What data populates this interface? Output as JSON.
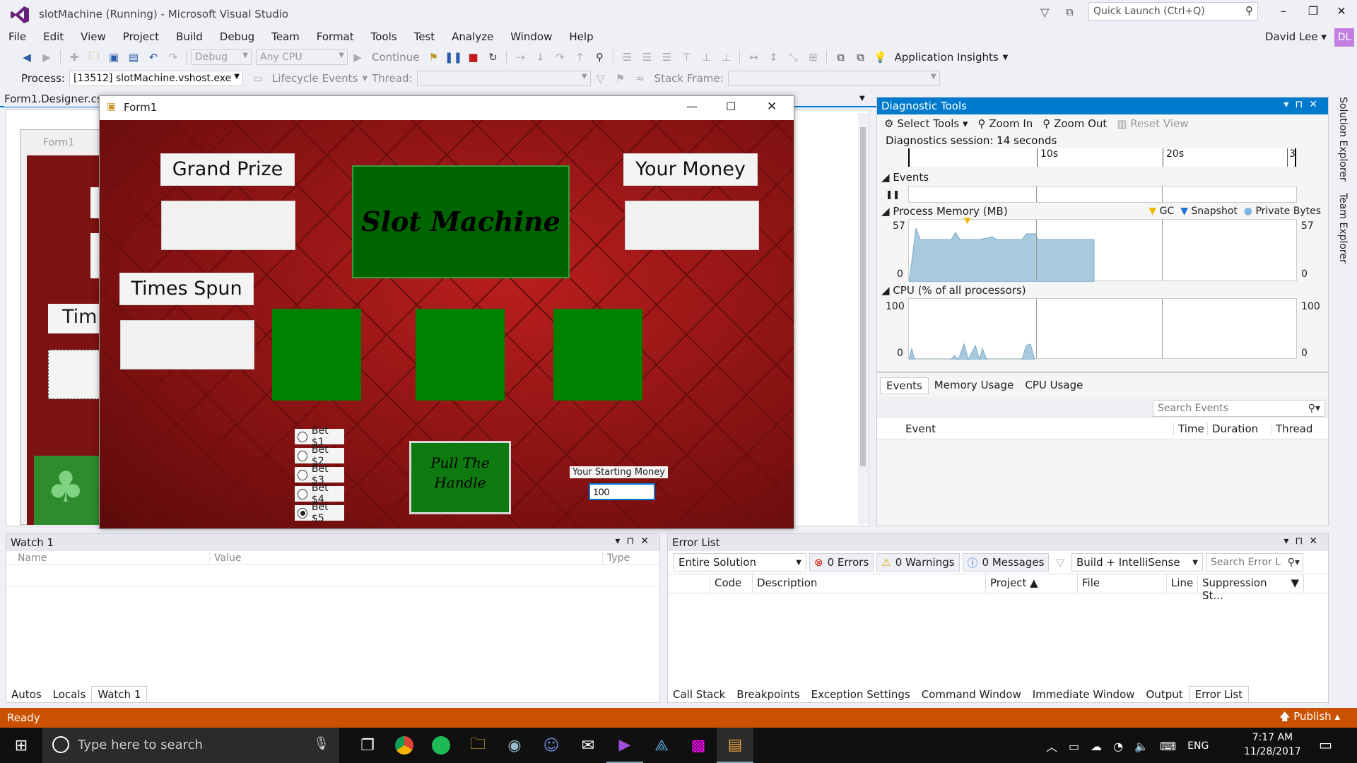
{
  "window": {
    "title": "slotMachine (Running) - Microsoft Visual Studio",
    "quick_launch_placeholder": "Quick Launch (Ctrl+Q)",
    "user": "David Lee",
    "avatar": "DL"
  },
  "menu": [
    "File",
    "Edit",
    "View",
    "Project",
    "Build",
    "Debug",
    "Team",
    "Format",
    "Tools",
    "Test",
    "Analyze",
    "Window",
    "Help"
  ],
  "toolbar": {
    "config": "Debug",
    "platform": "Any CPU",
    "continue": "Continue",
    "app_insights": "Application Insights",
    "process_label": "Process:",
    "process": "[13512] slotMachine.vshost.exe",
    "lifecycle": "Lifecycle Events",
    "thread_label": "Thread:",
    "stackframe_label": "Stack Frame:"
  },
  "doc_tab": "Form1.Designer.cs",
  "designer": {
    "form_title": "Form1",
    "partial_label": "Tim"
  },
  "form": {
    "title": "Form1",
    "grand_prize": "Grand Prize",
    "your_money": "Your Money",
    "slot_title": "Slot Machine",
    "times_spun": "Times Spun",
    "bets": [
      "Bet $1",
      "Bet $2",
      "Bet $3",
      "Bet $4",
      "Bet $5"
    ],
    "selected_bet": 4,
    "pull_button": "Pull The Handle",
    "starting_label": "Your Starting Money",
    "starting_value": "100"
  },
  "diagnostics": {
    "title": "Diagnostic Tools",
    "select_tools": "Select Tools",
    "zoom_in": "Zoom In",
    "zoom_out": "Zoom Out",
    "reset_view": "Reset View",
    "session": "Diagnostics session: 14 seconds",
    "ticks": [
      "10s",
      "20s",
      "3"
    ],
    "events": "Events",
    "process_memory": "Process Memory (MB)",
    "gc": "GC",
    "snapshot": "Snapshot",
    "private_bytes": "Private Bytes",
    "mem_max": "57",
    "mem_min": "0",
    "cpu": "CPU (% of all processors)",
    "cpu_max": "100",
    "cpu_min": "0",
    "tabs": [
      "Events",
      "Memory Usage",
      "CPU Usage"
    ],
    "search_placeholder": "Search Events",
    "columns": [
      "Event",
      "Time",
      "Duration",
      "Thread"
    ]
  },
  "side_tabs": [
    "Solution Explorer",
    "Team Explorer"
  ],
  "watch": {
    "title": "Watch 1",
    "columns": [
      "Name",
      "Value",
      "Type"
    ],
    "tabs": [
      "Autos",
      "Locals",
      "Watch 1"
    ]
  },
  "errors": {
    "title": "Error List",
    "scope": "Entire Solution",
    "errors": "0 Errors",
    "warnings": "0 Warnings",
    "messages": "0 Messages",
    "build": "Build + IntelliSense",
    "search_placeholder": "Search Error L",
    "columns": [
      "Code",
      "Description",
      "Project",
      "File",
      "Line",
      "Suppression St..."
    ]
  },
  "bottom_tabs": [
    "Call Stack",
    "Breakpoints",
    "Exception Settings",
    "Command Window",
    "Immediate Window",
    "Output",
    "Error List"
  ],
  "status": {
    "text": "Ready",
    "publish": "Publish"
  },
  "taskbar": {
    "search": "Type here to search",
    "lang": "ENG",
    "time": "7:17 AM",
    "date": "11/28/2017"
  },
  "colors": {
    "accent": "#007acc",
    "status": "#ca5100",
    "felt": "#008000"
  }
}
